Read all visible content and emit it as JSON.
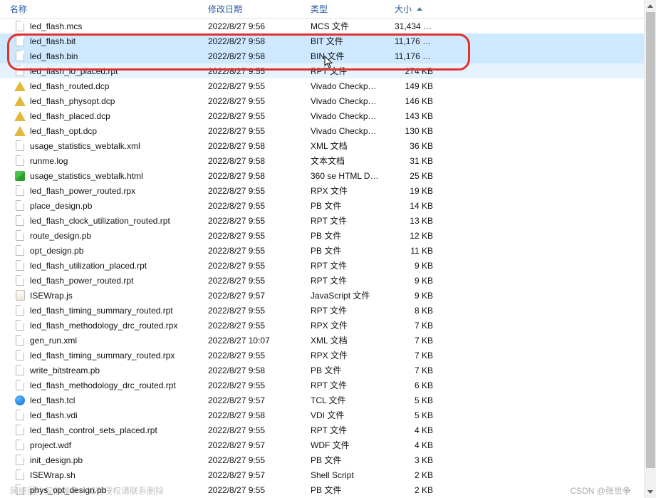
{
  "columns": {
    "name": "名称",
    "date": "修改日期",
    "type": "类型",
    "size": "大小"
  },
  "highlight": {
    "rows": [
      1,
      2
    ]
  },
  "files": [
    {
      "name": "led_flash.mcs",
      "date": "2022/8/27 9:56",
      "type": "MCS 文件",
      "size": "31,434 KB",
      "icon": "file",
      "sel": false
    },
    {
      "name": "led_flash.bit",
      "date": "2022/8/27 9:58",
      "type": "BIT 文件",
      "size": "11,176 KB",
      "icon": "file",
      "sel": true
    },
    {
      "name": "led_flash.bin",
      "date": "2022/8/27 9:58",
      "type": "BIN 文件",
      "size": "11,176 KB",
      "icon": "file",
      "sel": true
    },
    {
      "name": "led_flash_io_placed.rpt",
      "date": "2022/8/27 9:55",
      "type": "RPT 文件",
      "size": "274 KB",
      "icon": "file",
      "sel": false,
      "hl2": true
    },
    {
      "name": "led_flash_routed.dcp",
      "date": "2022/8/27 9:55",
      "type": "Vivado Checkpo...",
      "size": "149 KB",
      "icon": "dcp",
      "sel": false
    },
    {
      "name": "led_flash_physopt.dcp",
      "date": "2022/8/27 9:55",
      "type": "Vivado Checkpo...",
      "size": "146 KB",
      "icon": "dcp",
      "sel": false
    },
    {
      "name": "led_flash_placed.dcp",
      "date": "2022/8/27 9:55",
      "type": "Vivado Checkpo...",
      "size": "143 KB",
      "icon": "dcp",
      "sel": false
    },
    {
      "name": "led_flash_opt.dcp",
      "date": "2022/8/27 9:55",
      "type": "Vivado Checkpo...",
      "size": "130 KB",
      "icon": "dcp",
      "sel": false
    },
    {
      "name": "usage_statistics_webtalk.xml",
      "date": "2022/8/27 9:58",
      "type": "XML 文档",
      "size": "36 KB",
      "icon": "file",
      "sel": false
    },
    {
      "name": "runme.log",
      "date": "2022/8/27 9:58",
      "type": "文本文档",
      "size": "31 KB",
      "icon": "file",
      "sel": false
    },
    {
      "name": "usage_statistics_webtalk.html",
      "date": "2022/8/27 9:58",
      "type": "360 se HTML Do...",
      "size": "25 KB",
      "icon": "html",
      "sel": false
    },
    {
      "name": "led_flash_power_routed.rpx",
      "date": "2022/8/27 9:55",
      "type": "RPX 文件",
      "size": "19 KB",
      "icon": "file",
      "sel": false
    },
    {
      "name": "place_design.pb",
      "date": "2022/8/27 9:55",
      "type": "PB 文件",
      "size": "14 KB",
      "icon": "file",
      "sel": false
    },
    {
      "name": "led_flash_clock_utilization_routed.rpt",
      "date": "2022/8/27 9:55",
      "type": "RPT 文件",
      "size": "13 KB",
      "icon": "file",
      "sel": false
    },
    {
      "name": "route_design.pb",
      "date": "2022/8/27 9:55",
      "type": "PB 文件",
      "size": "12 KB",
      "icon": "file",
      "sel": false
    },
    {
      "name": "opt_design.pb",
      "date": "2022/8/27 9:55",
      "type": "PB 文件",
      "size": "11 KB",
      "icon": "file",
      "sel": false
    },
    {
      "name": "led_flash_utilization_placed.rpt",
      "date": "2022/8/27 9:55",
      "type": "RPT 文件",
      "size": "9 KB",
      "icon": "file",
      "sel": false
    },
    {
      "name": "led_flash_power_routed.rpt",
      "date": "2022/8/27 9:55",
      "type": "RPT 文件",
      "size": "9 KB",
      "icon": "file",
      "sel": false
    },
    {
      "name": "ISEWrap.js",
      "date": "2022/8/27 9:57",
      "type": "JavaScript 文件",
      "size": "9 KB",
      "icon": "js",
      "sel": false
    },
    {
      "name": "led_flash_timing_summary_routed.rpt",
      "date": "2022/8/27 9:55",
      "type": "RPT 文件",
      "size": "8 KB",
      "icon": "file",
      "sel": false
    },
    {
      "name": "led_flash_methodology_drc_routed.rpx",
      "date": "2022/8/27 9:55",
      "type": "RPX 文件",
      "size": "7 KB",
      "icon": "file",
      "sel": false
    },
    {
      "name": "gen_run.xml",
      "date": "2022/8/27 10:07",
      "type": "XML 文档",
      "size": "7 KB",
      "icon": "file",
      "sel": false
    },
    {
      "name": "led_flash_timing_summary_routed.rpx",
      "date": "2022/8/27 9:55",
      "type": "RPX 文件",
      "size": "7 KB",
      "icon": "file",
      "sel": false
    },
    {
      "name": "write_bitstream.pb",
      "date": "2022/8/27 9:58",
      "type": "PB 文件",
      "size": "7 KB",
      "icon": "file",
      "sel": false
    },
    {
      "name": "led_flash_methodology_drc_routed.rpt",
      "date": "2022/8/27 9:55",
      "type": "RPT 文件",
      "size": "6 KB",
      "icon": "file",
      "sel": false
    },
    {
      "name": "led_flash.tcl",
      "date": "2022/8/27 9:57",
      "type": "TCL 文件",
      "size": "5 KB",
      "icon": "tcl",
      "sel": false
    },
    {
      "name": "led_flash.vdi",
      "date": "2022/8/27 9:58",
      "type": "VDI 文件",
      "size": "5 KB",
      "icon": "file",
      "sel": false
    },
    {
      "name": "led_flash_control_sets_placed.rpt",
      "date": "2022/8/27 9:55",
      "type": "RPT 文件",
      "size": "4 KB",
      "icon": "file",
      "sel": false
    },
    {
      "name": "project.wdf",
      "date": "2022/8/27 9:57",
      "type": "WDF 文件",
      "size": "4 KB",
      "icon": "file",
      "sel": false
    },
    {
      "name": "init_design.pb",
      "date": "2022/8/27 9:55",
      "type": "PB 文件",
      "size": "3 KB",
      "icon": "file",
      "sel": false
    },
    {
      "name": "ISEWrap.sh",
      "date": "2022/8/27 9:57",
      "type": "Shell Script",
      "size": "2 KB",
      "icon": "file",
      "sel": false
    },
    {
      "name": "phys_opt_design.pb",
      "date": "2022/8/27 9:55",
      "type": "PB 文件",
      "size": "2 KB",
      "icon": "file",
      "sel": false
    }
  ],
  "watermarks": {
    "left": "网络图片仅供展示，如有侵权请联系删除",
    "right": "CSDN @张世争"
  }
}
